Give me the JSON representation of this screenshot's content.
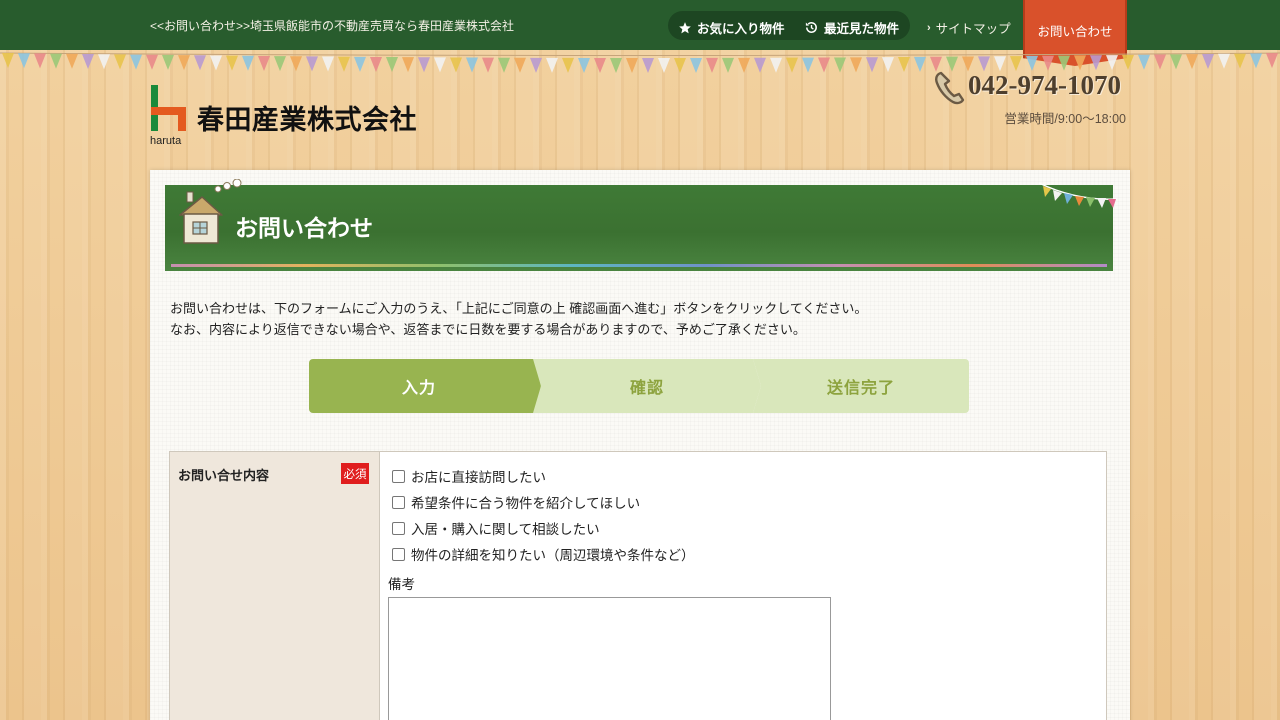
{
  "topbar": {
    "breadcrumb": "<<お問い合わせ>>埼玉県飯能市の不動産売買なら春田産業株式会社",
    "favorites_label": "お気に入り物件",
    "recent_label": "最近見た物件",
    "sitemap_label": "サイトマップ",
    "contact_tab_label": "お問い合わせ"
  },
  "header": {
    "logo_text": "haruta",
    "company_name": "春田産業株式会社",
    "phone": "042-974-1070",
    "hours": "営業時間/9:00～18:00"
  },
  "page": {
    "title": "お問い合わせ",
    "intro_line1": "お問い合わせは、下のフォームにご入力のうえ、「上記にご同意の上 確認画面へ進む」ボタンをクリックしてください。",
    "intro_line2": "なお、内容により返信できない場合や、返答までに日数を要する場合がありますので、予めご了承ください。"
  },
  "steps": [
    {
      "label": "入力",
      "active": true
    },
    {
      "label": "確認",
      "active": false
    },
    {
      "label": "送信完了",
      "active": false
    }
  ],
  "form": {
    "inquiry_label": "お問い合せ内容",
    "required_badge": "必須",
    "options": [
      {
        "label": "お店に直接訪問したい",
        "checked": false
      },
      {
        "label": "希望条件に合う物件を紹介してほしい",
        "checked": false
      },
      {
        "label": "入居・購入に関して相談したい",
        "checked": false
      },
      {
        "label": "物件の詳細を知りたい（周辺環境や条件など）",
        "checked": false
      }
    ],
    "remarks_label": "備考",
    "remarks_value": ""
  },
  "colors": {
    "topbar": "#285c2d",
    "contact_tab": "#d9512b",
    "header_green": "#3f7a36",
    "step_active": "#98b450",
    "step_inactive": "#d9e7bb",
    "required": "#e01e1e"
  }
}
